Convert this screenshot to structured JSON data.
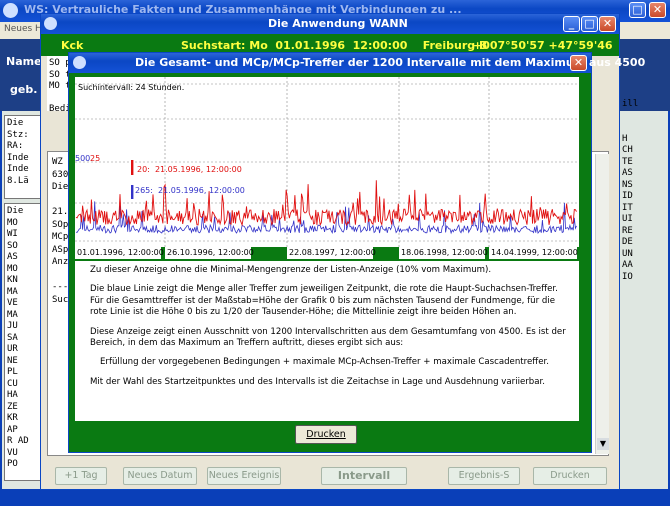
{
  "back_window": {
    "title": "WS: Vertrauliche Fakten und Zusammenhänge mit Verbindungen zu ...",
    "menu_item": "Neues H",
    "name_label": "Name",
    "geb_label": "geb.",
    "left_text_top": [
      "Die",
      "Stz:",
      "RA:",
      "Inde",
      "Inde",
      "8.Lä"
    ],
    "left_text_bottom": [
      "Die",
      "MO",
      "WI",
      "SO",
      "AS",
      "MO",
      "KN",
      "MA",
      "VE",
      "MA",
      "JU",
      "SA",
      "UR",
      "NE",
      "PL",
      "CU",
      "HA",
      "ZE",
      "KR",
      "AP",
      "R AD",
      "VU",
      "PO"
    ],
    "right_text": [
      "ill",
      "",
      "",
      "H",
      "CH",
      "TE",
      "AS",
      "NS",
      "ID",
      "IT",
      "UI",
      "RE",
      "DE",
      "UN",
      "AA",
      "IO",
      "",
      "",
      "",
      "",
      "",
      "",
      "",
      "",
      "",
      "",
      ""
    ]
  },
  "mid_window": {
    "title": "Die Anwendung WANN",
    "kck": "Kck",
    "search_start": "Suchstart: Mo  01.01.1996  12:00:00    Freiburg B",
    "coords": "+007°50'57  +47°59'46",
    "left_lines": [
      "SO p",
      "SO t",
      "MO t",
      "",
      "Bedi"
    ],
    "panel_lines": [
      "WZ",
      "630",
      "Die",
      "",
      "21.",
      "SOp",
      "MCp",
      "ASp",
      "Anz",
      "",
      "---",
      "Suc"
    ],
    "buttons": {
      "prev_day": "+1 Tag",
      "new_date": "Neues Datum",
      "new_event": "Neues Ereignis",
      "interval": "Intervall",
      "result": "Ergebnis-S",
      "print": "Drucken"
    }
  },
  "dialog": {
    "title": "Die Gesamt- und MCp/MCp-Treffer der 1200 Intervalle mit dem Maximum aus 4500",
    "interval_label": "Suchintervall: 24 Stunden.",
    "y_label_blue": "500",
    "y_label_red": "25",
    "max_red": "20:  21.05.1996, 12:00:00",
    "max_blue": "265:  21.05.1996, 12:00:00",
    "dates": [
      "01.01.1996, 12:00:00",
      "26.10.1996, 12:00:00",
      "22.08.1997, 12:00:00",
      "18.06.1998, 12:00:00",
      "14.04.1999, 12:00:00"
    ],
    "info": [
      "Zu dieser Anzeige ohne die Minimal-Mengengrenze der Listen-Anzeige (10% vom Maximum).",
      "Die blaue Linie zeigt die Menge aller Treffer zum jeweiligen Zeitpunkt, die rote die Haupt-Suchachsen-Treffer. Für die Gesamttreffer ist der Maßstab=Höhe der Grafik 0 bis zum nächsten Tausend der Fundmenge, für die rote Linie ist die Höhe 0 bis zu  1/20  der Tausender-Höhe; die Mittellinie zeigt ihre beiden Höhen an.",
      "Diese Anzeige zeigt einen Ausschnitt von 1200 Intervallschritten aus dem Gesamtumfang von 4500. Es ist der Bereich, in dem das Maximum an Treffern auftritt, dieses ergibt sich aus:",
      "Erfüllung der vorgegebenen Bedingungen + maximale MCp-Achsen-Treffer + maximale Cascadentreffer.",
      "Mit der Wahl des Startzeitpunktes und des Intervalls ist die Zeitachse in Lage und Ausdehnung variierbar."
    ],
    "print_button": "Drucken",
    "colors": {
      "blue_series": "#3232c8",
      "red_series": "#e01010",
      "frame_green": "#0a7a12"
    }
  }
}
